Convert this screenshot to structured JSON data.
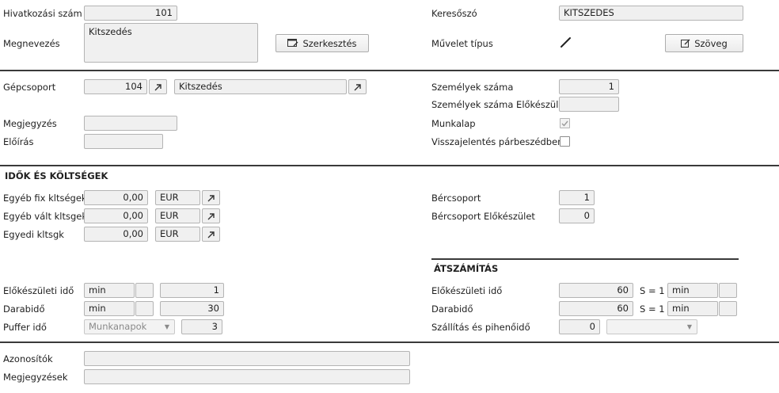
{
  "header": {
    "ref_no_label": "Hivatkozási szám",
    "ref_no_value": "101",
    "name_label": "Megnevezés",
    "name_value": "Kitszedés",
    "edit_button": "Szerkesztés",
    "keyword_label": "Keresőszó",
    "keyword_value": "KITSZEDES",
    "op_type_label": "Művelet típus",
    "text_button": "Szöveg"
  },
  "machine": {
    "group_label": "Gépcsoport",
    "group_code": "104",
    "group_name": "Kitszedés",
    "persons_label": "Személyek száma",
    "persons_value": "1",
    "persons_setup_label": "Személyek száma Előkészület",
    "persons_setup_value": "",
    "note_label": "Megjegyzés",
    "note_value": "",
    "rule_label": "Előírás",
    "rule_value": "",
    "worksheet_label": "Munkalap",
    "worksheet_checked": true,
    "feedback_label": "Visszajelentés párbeszédben",
    "feedback_checked": false
  },
  "costs": {
    "section_title": "IDŐK ÉS KÖLTSÉGEK",
    "rows": [
      {
        "label": "Egyéb fix kltségek",
        "value": "0,00",
        "currency": "EUR"
      },
      {
        "label": "Egyéb vált kltsgek",
        "value": "0,00",
        "currency": "EUR"
      },
      {
        "label": "Egyedi kltsgk",
        "value": "0,00",
        "currency": "EUR"
      }
    ],
    "wage_group_label": "Bércsoport",
    "wage_group_value": "1",
    "wage_group_setup_label": "Bércsoport Előkészület",
    "wage_group_setup_value": "0"
  },
  "times": {
    "setup_label": "Előkészületi idő",
    "setup_unit": "min",
    "setup_value": "1",
    "piece_label": "Darabidő",
    "piece_unit": "min",
    "piece_value": "30",
    "buffer_label": "Puffer idő",
    "buffer_unit": "Munkanapok",
    "buffer_value": "3"
  },
  "conversion": {
    "section_title": "ÁTSZÁMÍTÁS",
    "setup_label": "Előkészületi idő",
    "setup_value": "60",
    "setup_factor": "S = 1",
    "setup_unit": "min",
    "piece_label": "Darabidő",
    "piece_value": "60",
    "piece_factor": "S = 1",
    "piece_unit": "min",
    "transport_label": "Szállítás és pihenőidő",
    "transport_value": "0",
    "transport_unit": ""
  },
  "footer": {
    "ids_label": "Azonosítók",
    "ids_value": "",
    "remarks_label": "Megjegyzések",
    "remarks_value": ""
  }
}
